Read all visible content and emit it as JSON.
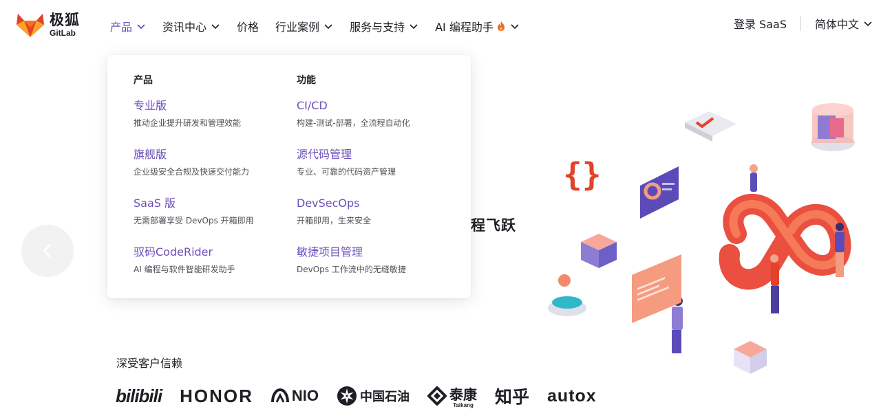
{
  "brand": {
    "name_cn": "极狐",
    "name_en": "GitLab",
    "accent_color": "#6b4fbb",
    "logo_orange": "#e24329"
  },
  "nav": {
    "items": [
      {
        "label": "产品",
        "active": true,
        "has_chevron": true
      },
      {
        "label": "资讯中心",
        "active": false,
        "has_chevron": true
      },
      {
        "label": "价格",
        "active": false,
        "has_chevron": false
      },
      {
        "label": "行业案例",
        "active": false,
        "has_chevron": true
      },
      {
        "label": "服务与支持",
        "active": false,
        "has_chevron": true
      },
      {
        "label": "AI 编程助手",
        "active": false,
        "has_chevron": true,
        "icon": "fire-icon"
      }
    ],
    "login_label": "登录 SaaS",
    "language_label": "简体中文"
  },
  "dropdown": {
    "columns": [
      {
        "heading": "产品",
        "items": [
          {
            "title": "专业版",
            "desc": "推动企业提升研发和管理效能"
          },
          {
            "title": "旗舰版",
            "desc": "企业级安全合规及快速交付能力"
          },
          {
            "title": "SaaS 版",
            "desc": "无需部署享受 DevOps 开箱即用"
          },
          {
            "title": "驭码CodeRider",
            "desc": "AI 编程与软件智能研发助手"
          }
        ]
      },
      {
        "heading": "功能",
        "items": [
          {
            "title": "CI/CD",
            "desc": "构建-测试-部署，全流程自动化"
          },
          {
            "title": "源代码管理",
            "desc": "专业、可靠的代码资产管理"
          },
          {
            "title": "DevSecOps",
            "desc": "开箱即用，生来安全"
          },
          {
            "title": "敏捷项目管理",
            "desc": "DevOps 工作流中的无缝敏捷"
          }
        ]
      }
    ]
  },
  "hero": {
    "partial_heading": "程飞跃"
  },
  "customers": {
    "title": "深受客户信赖",
    "logos": [
      "bilibili",
      "HONOR",
      "NIO",
      "中国石油",
      "泰康",
      "Taikang",
      "知乎",
      "autox"
    ]
  }
}
